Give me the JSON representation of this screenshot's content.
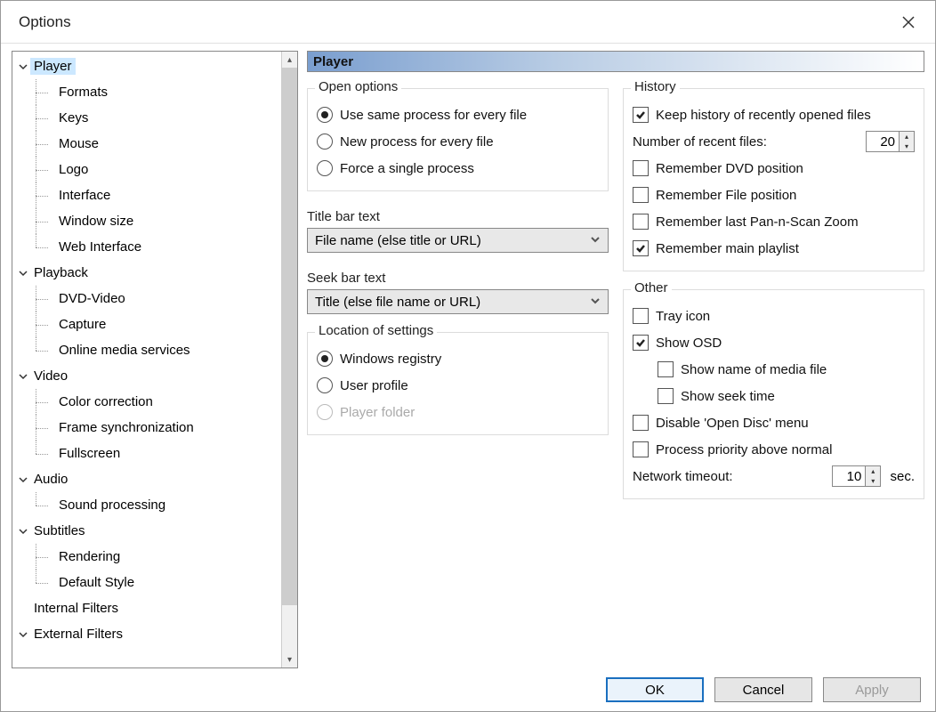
{
  "window": {
    "title": "Options"
  },
  "tree": {
    "items": [
      {
        "label": "Player",
        "type": "parent",
        "selected": true
      },
      {
        "label": "Formats",
        "type": "child"
      },
      {
        "label": "Keys",
        "type": "child"
      },
      {
        "label": "Mouse",
        "type": "child"
      },
      {
        "label": "Logo",
        "type": "child"
      },
      {
        "label": "Interface",
        "type": "child"
      },
      {
        "label": "Window size",
        "type": "child"
      },
      {
        "label": "Web Interface",
        "type": "child",
        "last": true
      },
      {
        "label": "Playback",
        "type": "parent"
      },
      {
        "label": "DVD-Video",
        "type": "child"
      },
      {
        "label": "Capture",
        "type": "child"
      },
      {
        "label": "Online media services",
        "type": "child",
        "last": true
      },
      {
        "label": "Video",
        "type": "parent"
      },
      {
        "label": "Color correction",
        "type": "child"
      },
      {
        "label": "Frame synchronization",
        "type": "child"
      },
      {
        "label": "Fullscreen",
        "type": "child",
        "last": true
      },
      {
        "label": "Audio",
        "type": "parent"
      },
      {
        "label": "Sound processing",
        "type": "child",
        "last": true
      },
      {
        "label": "Subtitles",
        "type": "parent"
      },
      {
        "label": "Rendering",
        "type": "child"
      },
      {
        "label": "Default Style",
        "type": "child",
        "last": true
      },
      {
        "label": "Internal Filters",
        "type": "leafparent"
      },
      {
        "label": "External Filters",
        "type": "parent"
      }
    ]
  },
  "pane": {
    "header": "Player",
    "open_options": {
      "legend": "Open options",
      "opt1": "Use same process for every file",
      "opt2": "New process for every file",
      "opt3": "Force a single process",
      "selected": 1
    },
    "titlebar_text": {
      "label": "Title bar text",
      "value": "File name (else title or URL)"
    },
    "seekbar_text": {
      "label": "Seek bar text",
      "value": "Title (else file name or URL)"
    },
    "location": {
      "legend": "Location of settings",
      "opt1": "Windows registry",
      "opt2": "User profile",
      "opt3": "Player folder",
      "selected": 1,
      "opt3_disabled": true
    },
    "history": {
      "legend": "History",
      "keep_history": {
        "label": "Keep history of recently opened files",
        "checked": true
      },
      "recent_label": "Number of recent files:",
      "recent_value": "20",
      "remember_dvd": {
        "label": "Remember DVD position",
        "checked": false
      },
      "remember_file": {
        "label": "Remember File position",
        "checked": false
      },
      "remember_pan": {
        "label": "Remember last Pan-n-Scan Zoom",
        "checked": false
      },
      "remember_playlist": {
        "label": "Remember main playlist",
        "checked": true
      }
    },
    "other": {
      "legend": "Other",
      "tray": {
        "label": "Tray icon",
        "checked": false
      },
      "osd": {
        "label": "Show OSD",
        "checked": true
      },
      "osd_name": {
        "label": "Show name of media file",
        "checked": false
      },
      "osd_seek": {
        "label": "Show seek time",
        "checked": false
      },
      "disable_open_disc": {
        "label": "Disable 'Open Disc' menu",
        "checked": false
      },
      "priority": {
        "label": "Process priority above normal",
        "checked": false
      },
      "timeout_label": "Network timeout:",
      "timeout_value": "10",
      "timeout_unit": "sec."
    }
  },
  "buttons": {
    "ok": "OK",
    "cancel": "Cancel",
    "apply": "Apply"
  }
}
